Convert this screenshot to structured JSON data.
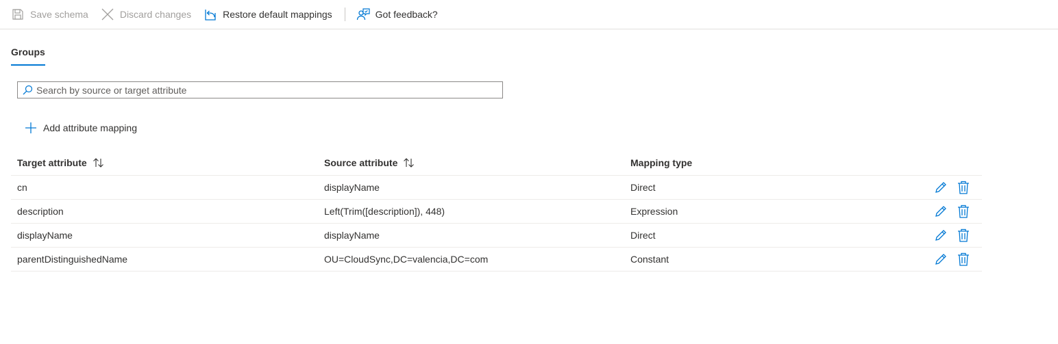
{
  "toolbar": {
    "save_label": "Save schema",
    "discard_label": "Discard changes",
    "restore_label": "Restore default mappings",
    "feedback_label": "Got feedback?"
  },
  "tabs": [
    {
      "label": "Groups",
      "selected": true
    }
  ],
  "search": {
    "placeholder": "Search by source or target attribute",
    "value": ""
  },
  "add_mapping_label": "Add attribute mapping",
  "table": {
    "headers": {
      "target": "Target attribute",
      "source": "Source attribute",
      "type": "Mapping type"
    },
    "rows": [
      {
        "target": "cn",
        "source": "displayName",
        "type": "Direct"
      },
      {
        "target": "description",
        "source": "Left(Trim([description]), 448)",
        "type": "Expression"
      },
      {
        "target": "displayName",
        "source": "displayName",
        "type": "Direct"
      },
      {
        "target": "parentDistinguishedName",
        "source": "OU=CloudSync,DC=valencia,DC=com",
        "type": "Constant"
      }
    ]
  },
  "colors": {
    "accent": "#0078d4",
    "disabled_text": "#a19f9d",
    "text": "#323130",
    "divider": "#edebe9"
  },
  "icons": {
    "save": "save-icon",
    "discard": "close-icon",
    "restore": "restore-icon",
    "feedback": "feedback-icon",
    "search": "search-icon",
    "add": "plus-icon",
    "sort": "sort-icon",
    "edit": "pencil-icon",
    "delete": "trash-icon"
  }
}
